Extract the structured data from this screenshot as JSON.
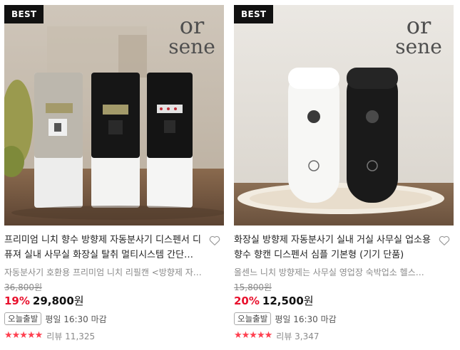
{
  "products": [
    {
      "badge": "BEST",
      "brand_logo_line1": "or",
      "brand_logo_line2": "sene",
      "title": "프리미엄 니치 향수 방향제 자동분사기 디스펜서 디퓨져 실내 사무실 화장실 탈취 멀티시스템 간단…",
      "subtitle": "자동분사기 호환용 프리미엄 니치 리필캔 <방향제 자…",
      "original_price": "36,800원",
      "discount": "19%",
      "price": "29,800",
      "currency": "원",
      "shipping_tag": "오늘출발",
      "shipping_note": "평일 16:30 마감",
      "stars": "★★★★★",
      "rating": 5,
      "review_label": "리뷰 11,325"
    },
    {
      "badge": "BEST",
      "brand_logo_line1": "or",
      "brand_logo_line2": "sene",
      "title": "화장실 방향제 자동분사기 실내 거실 사무실 업소용 향수 향캔 디스펜서 심플 기본형 (기기 단품)",
      "subtitle": "올센느 니치 방향제는 사무실 영업장 숙박업소 헬스…",
      "original_price": "15,800원",
      "discount": "20%",
      "price": "12,500",
      "currency": "원",
      "shipping_tag": "오늘출발",
      "shipping_note": "평일 16:30 마감",
      "stars": "★★★★★",
      "rating": 5,
      "review_label": "리뷰 3,347"
    }
  ],
  "icons": {
    "heart": "heart-outline-icon",
    "star": "star-icon"
  },
  "colors": {
    "discount": "#e8112d",
    "stars": "#ff4050",
    "badge_bg": "#111111"
  }
}
